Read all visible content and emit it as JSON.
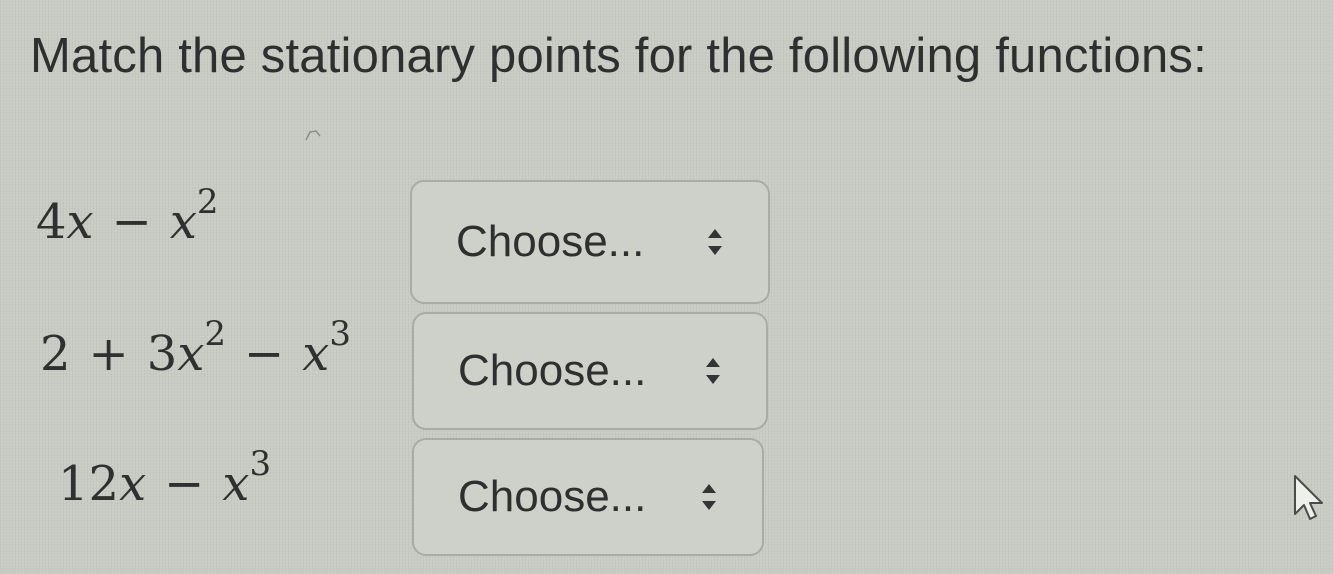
{
  "question": {
    "title": "Match the stationary points for the following functions:"
  },
  "rows": [
    {
      "expression": {
        "coef": "4",
        "var1": "x",
        "op": "−",
        "var2": "x",
        "exp2": "2"
      },
      "select": {
        "label": "Choose...",
        "icon": "up-down-chevron-icon"
      }
    },
    {
      "expression": {
        "const": "2",
        "op1": "+",
        "coef": "3",
        "var1": "x",
        "exp1": "2",
        "op2": "−",
        "var2": "x",
        "exp2": "3"
      },
      "select": {
        "label": "Choose...",
        "icon": "up-down-chevron-icon"
      }
    },
    {
      "expression": {
        "coef": "12",
        "var1": "x",
        "op": "−",
        "var2": "x",
        "exp2": "3"
      },
      "select": {
        "label": "Choose...",
        "icon": "up-down-chevron-icon"
      }
    }
  ],
  "colors": {
    "background": "#c9ccc4",
    "text": "#2d2f2e",
    "select_border": "#a9aca6"
  }
}
